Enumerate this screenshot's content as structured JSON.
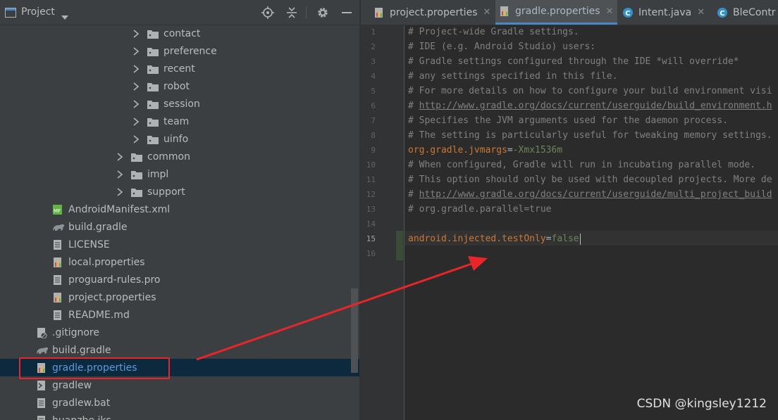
{
  "project_panel": {
    "title": "Project",
    "tree": [
      {
        "label": "contact",
        "kind": "folder",
        "depth": 2,
        "expandable": true
      },
      {
        "label": "preference",
        "kind": "folder",
        "depth": 2,
        "expandable": true
      },
      {
        "label": "recent",
        "kind": "folder",
        "depth": 2,
        "expandable": true
      },
      {
        "label": "robot",
        "kind": "folder",
        "depth": 2,
        "expandable": true
      },
      {
        "label": "session",
        "kind": "folder",
        "depth": 2,
        "expandable": true
      },
      {
        "label": "team",
        "kind": "folder",
        "depth": 2,
        "expandable": true
      },
      {
        "label": "uinfo",
        "kind": "folder",
        "depth": 2,
        "expandable": true
      },
      {
        "label": "common",
        "kind": "folder",
        "depth": 1,
        "expandable": true
      },
      {
        "label": "impl",
        "kind": "folder",
        "depth": 1,
        "expandable": true
      },
      {
        "label": "support",
        "kind": "folder",
        "depth": 1,
        "expandable": true
      },
      {
        "label": "AndroidManifest.xml",
        "kind": "manifest",
        "depth": 0
      },
      {
        "label": "build.gradle",
        "kind": "gradle",
        "depth": 0
      },
      {
        "label": "LICENSE",
        "kind": "text",
        "depth": 0
      },
      {
        "label": "local.properties",
        "kind": "properties",
        "depth": 0
      },
      {
        "label": "proguard-rules.pro",
        "kind": "text",
        "depth": 0
      },
      {
        "label": "project.properties",
        "kind": "properties",
        "depth": 0
      },
      {
        "label": "README.md",
        "kind": "text",
        "depth": 0
      },
      {
        "label": ".gitignore",
        "kind": "ignore",
        "depth": -1
      },
      {
        "label": "build.gradle",
        "kind": "gradle",
        "depth": -1
      },
      {
        "label": "gradle.properties",
        "kind": "properties",
        "depth": -1,
        "selected": true
      },
      {
        "label": "gradlew",
        "kind": "shell",
        "depth": -1
      },
      {
        "label": "gradlew.bat",
        "kind": "text",
        "depth": -1
      },
      {
        "label": "huanzhe.jks",
        "kind": "text",
        "depth": -1
      }
    ]
  },
  "editor": {
    "tabs": [
      {
        "label": "project.properties",
        "kind": "properties",
        "active": false,
        "closable": true
      },
      {
        "label": "gradle.properties",
        "kind": "properties",
        "active": true,
        "closable": true
      },
      {
        "label": "Intent.java",
        "kind": "class",
        "active": false,
        "closable": true
      },
      {
        "label": "BleContr",
        "kind": "class",
        "active": false,
        "closable": false
      }
    ],
    "current_line": 15,
    "lines": [
      [
        {
          "t": "# Project-wide Gradle settings.",
          "c": "comment"
        }
      ],
      [
        {
          "t": "# IDE (e.g. Android Studio) users:",
          "c": "comment"
        }
      ],
      [
        {
          "t": "# Gradle settings configured through the IDE *will override*",
          "c": "comment"
        }
      ],
      [
        {
          "t": "# any settings specified in this file.",
          "c": "comment"
        }
      ],
      [
        {
          "t": "# For more details on how to configure your build environment visi",
          "c": "comment"
        }
      ],
      [
        {
          "t": "# ",
          "c": "comment"
        },
        {
          "t": "http://www.gradle.org/docs/current/userguide/build_environment.h",
          "c": "link"
        }
      ],
      [
        {
          "t": "# Specifies the JVM arguments used for the daemon process.",
          "c": "comment"
        }
      ],
      [
        {
          "t": "# The setting is particularly useful for tweaking memory settings.",
          "c": "comment"
        }
      ],
      [
        {
          "t": "org.gradle.jvmargs",
          "c": "key"
        },
        {
          "t": "=",
          "c": "eq"
        },
        {
          "t": "-Xmx1536m",
          "c": "val"
        }
      ],
      [
        {
          "t": "# When configured, Gradle will run in incubating parallel mode.",
          "c": "comment"
        }
      ],
      [
        {
          "t": "# This option should only be used with decoupled projects. More de",
          "c": "comment"
        }
      ],
      [
        {
          "t": "# ",
          "c": "comment"
        },
        {
          "t": "http://www.gradle.org/docs/current/userguide/multi_project_build",
          "c": "link"
        }
      ],
      [
        {
          "t": "# org.gradle.parallel=true",
          "c": "comment"
        }
      ],
      [],
      [
        {
          "t": "android.injected.testOnly",
          "c": "key"
        },
        {
          "t": "=",
          "c": "eq"
        },
        {
          "t": "false",
          "c": "val"
        }
      ],
      []
    ]
  },
  "watermark": "CSDN @kingsley1212",
  "colors": {
    "annotation_red": "#e8262a",
    "selection_bg": "#0d293e",
    "tab_underline": "#4a88c7"
  }
}
